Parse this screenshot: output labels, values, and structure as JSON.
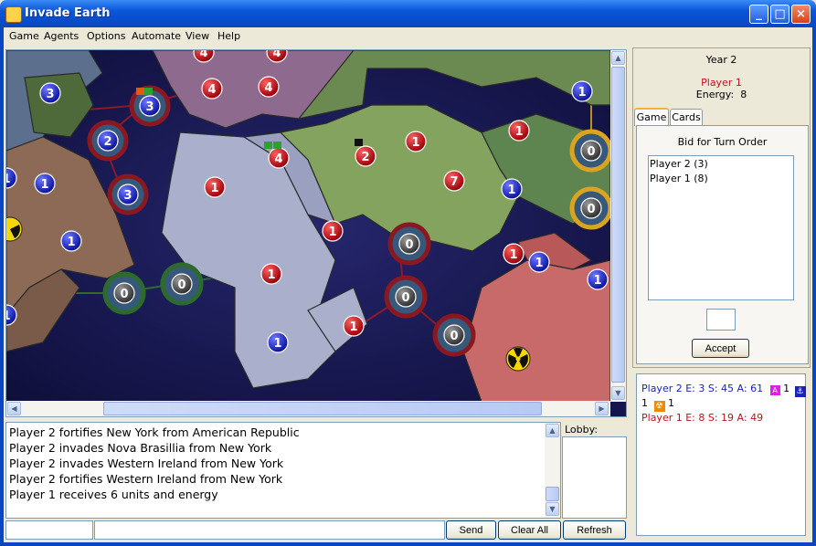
{
  "window": {
    "title": "Invade Earth"
  },
  "menu": [
    "Game",
    "Agents",
    "Options",
    "Automate",
    "View",
    "Help"
  ],
  "map": {
    "territories": [
      {
        "owner": "p2",
        "units": "3"
      },
      {
        "owner": "p1",
        "units": "4"
      },
      {
        "owner": "p1",
        "units": "4"
      },
      {
        "owner": "p1",
        "units": "4"
      },
      {
        "owner": "p1",
        "units": "4"
      },
      {
        "owner": "p2",
        "units": "3"
      },
      {
        "owner": "p2",
        "units": "2"
      },
      {
        "owner": "p2",
        "units": "3"
      },
      {
        "owner": "p2",
        "units": "1"
      },
      {
        "owner": "p2",
        "units": "1"
      },
      {
        "owner": "p1",
        "units": "1"
      },
      {
        "owner": "p1",
        "units": "4"
      },
      {
        "owner": "p1",
        "units": "2"
      },
      {
        "owner": "p1",
        "units": "1"
      },
      {
        "owner": "p1",
        "units": "1"
      },
      {
        "owner": "p2",
        "units": "1"
      },
      {
        "owner": "p1",
        "units": "7"
      },
      {
        "owner": "p1",
        "units": "1"
      },
      {
        "owner": "p1",
        "units": "1"
      },
      {
        "owner": "p1",
        "units": "1"
      },
      {
        "owner": "p2",
        "units": "1"
      },
      {
        "owner": "p2",
        "units": "1"
      },
      {
        "owner": "p2",
        "units": "1"
      },
      {
        "owner": "p2",
        "units": "1"
      },
      {
        "owner": "p1",
        "units": "1"
      },
      {
        "owner": "p2",
        "units": "1"
      },
      {
        "owner": "p2",
        "units": "1"
      },
      {
        "owner": "neutral",
        "units": "0"
      },
      {
        "owner": "neutral",
        "units": "0"
      },
      {
        "owner": "neutral",
        "units": "0"
      },
      {
        "owner": "neutral",
        "units": "0"
      },
      {
        "owner": "neutral",
        "units": "0"
      },
      {
        "owner": "neutral",
        "units": "0"
      },
      {
        "owner": "neutral",
        "units": "0"
      }
    ]
  },
  "log": [
    "Player 2 fortifies New York from American Republic",
    "Player 2 invades Nova Brasillia from New York",
    "Player 2 invades Western Ireland from New York",
    "Player 2 fortifies Western Ireland from New York",
    "Player 1 receives 6 units and energy"
  ],
  "lobby": {
    "label": "Lobby:"
  },
  "chat": {
    "name_value": "",
    "message_value": ""
  },
  "buttons": {
    "send": "Send",
    "clear_all": "Clear All",
    "refresh": "Refresh",
    "accept": "Accept"
  },
  "info": {
    "year": "Year 2",
    "player": "Player 1",
    "energy_label": "Energy:",
    "energy_value": "8"
  },
  "tabs": [
    "Game",
    "Cards"
  ],
  "bid": {
    "title": "Bid for Turn Order",
    "entries": [
      "Player 2 (3)",
      "Player 1 (8)"
    ],
    "value": ""
  },
  "status": {
    "p2_line": "Player 2 E: 3 S: 45 A: 61",
    "p2_item1_count": "1",
    "p2_item2_count": "1",
    "p2_item3_count": "1",
    "p1_line": "Player 1 E: 8 S: 19 A: 49"
  },
  "colors": {
    "player1": "#c0101a",
    "player2": "#1a24b4",
    "neutral": "#505050",
    "titlebar": "#0a55d9",
    "ocean": "#15154d"
  }
}
